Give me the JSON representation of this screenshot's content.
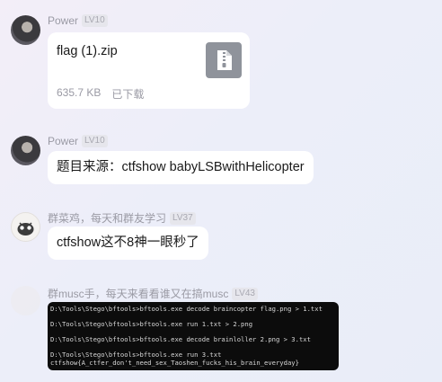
{
  "messages": [
    {
      "sender": "Power",
      "level": "LV10",
      "file": {
        "name": "flag (1).zip",
        "size": "635.7 KB",
        "status": "已下载",
        "icon": "zip-file-icon"
      }
    },
    {
      "sender": "Power",
      "level": "LV10",
      "text": "题目来源：ctfshow babyLSBwithHelicopter"
    },
    {
      "sender": "群菜鸡，每天和群友学习",
      "level": "LV37",
      "text": "ctfshow这不8神一眼秒了"
    },
    {
      "sender": "群musc手，每天来看看谁又在搞musc",
      "level": "LV43",
      "terminal_lines": [
        "D:\\Tools\\Stego\\bftools>bftools.exe decode braincopter flag.png > 1.txt",
        "",
        "D:\\Tools\\Stego\\bftools>bftools.exe run 1.txt > 2.png",
        "",
        "D:\\Tools\\Stego\\bftools>bftools.exe decode brainloller 2.png > 3.txt",
        "",
        "D:\\Tools\\Stego\\bftools>bftools.exe run 3.txt",
        "ctfshow{A_ctfer_don't_need_sex_Taoshen_fucks_his_brain_everyday}"
      ]
    }
  ],
  "colors": {
    "background": "#eceef9",
    "bubble": "#ffffff",
    "terminal": "#0c0c0c",
    "meta": "#9a9aa4"
  }
}
